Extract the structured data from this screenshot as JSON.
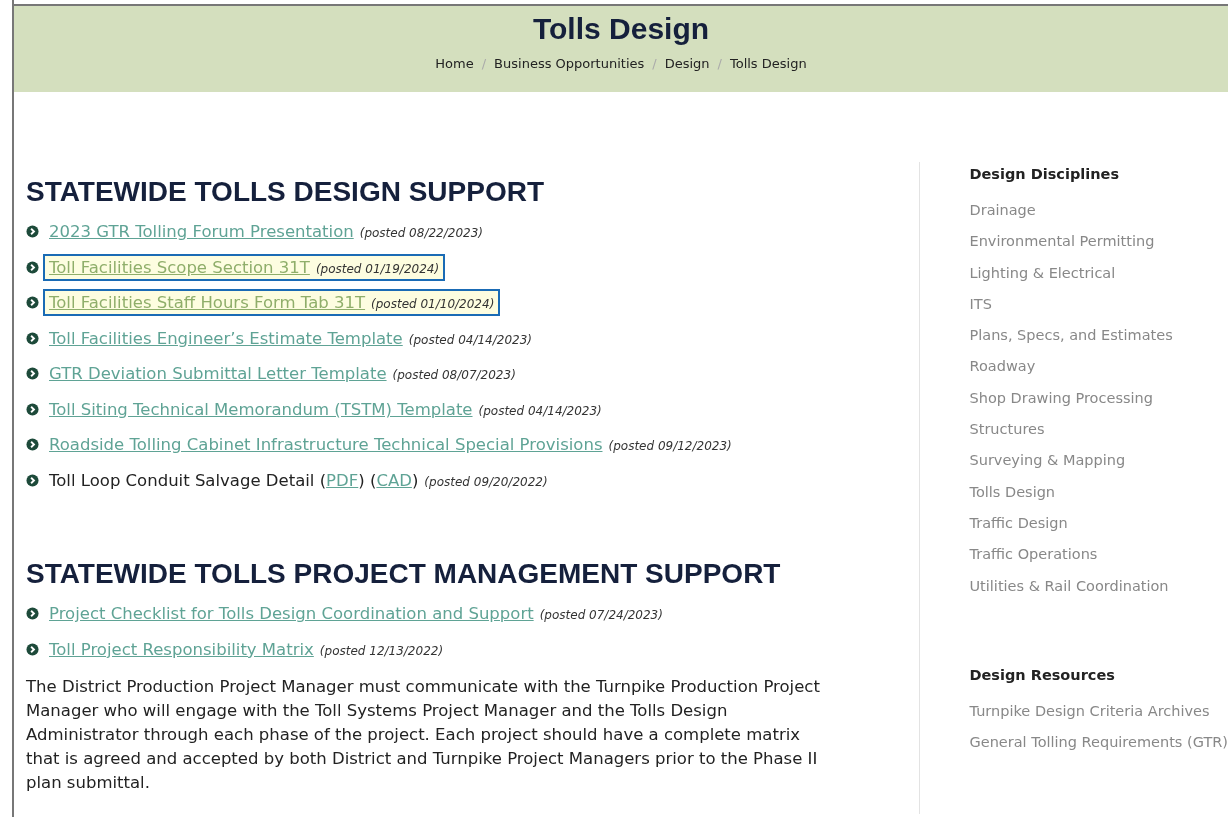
{
  "header": {
    "title": "Tolls Design",
    "breadcrumb": [
      {
        "label": "Home"
      },
      {
        "separator": "/",
        "label": "Business Opportunities"
      },
      {
        "separator": "/",
        "label": "Design"
      },
      {
        "separator": "/",
        "label": "Tolls Design"
      }
    ]
  },
  "sections": [
    {
      "heading": "STATEWIDE TOLLS DESIGN SUPPORT",
      "items": [
        {
          "kind": "link",
          "label": "2023 GTR Tolling Forum Presentation",
          "posted": "(posted 08/22/2023)",
          "highlighted": false
        },
        {
          "kind": "link",
          "label": "Toll Facilities Scope Section 31T",
          "posted": "(posted 01/19/2024)",
          "highlighted": true
        },
        {
          "kind": "link",
          "label": "Toll Facilities Staff Hours Form Tab 31T",
          "posted": "(posted 01/10/2024)",
          "highlighted": true
        },
        {
          "kind": "link",
          "label": "Toll Facilities Engineer’s Estimate Template",
          "posted": "(posted 04/14/2023)",
          "highlighted": false
        },
        {
          "kind": "link",
          "label": "GTR Deviation Submittal Letter Template",
          "posted": "(posted 08/07/2023)",
          "highlighted": false
        },
        {
          "kind": "link",
          "label": "Toll Siting Technical Memorandum (TSTM) Template",
          "posted": "(posted 04/14/2023)",
          "highlighted": false
        },
        {
          "kind": "link",
          "label": "Roadside Tolling Cabinet Infrastructure Technical Special Provisions",
          "posted": "(posted 09/12/2023)",
          "highlighted": false
        },
        {
          "kind": "mixed",
          "parts": [
            {
              "link": false,
              "text": "Toll Loop Conduit Salvage Detail ("
            },
            {
              "link": true,
              "text": "PDF"
            },
            {
              "link": false,
              "text": ") ("
            },
            {
              "link": true,
              "text": "CAD"
            },
            {
              "link": false,
              "text": ")"
            }
          ],
          "posted": "(posted 09/20/2022)",
          "highlighted": false
        }
      ]
    },
    {
      "heading": "STATEWIDE TOLLS PROJECT MANAGEMENT SUPPORT",
      "items": [
        {
          "kind": "link",
          "label": "Project Checklist for Tolls Design Coordination and Support",
          "posted": "(posted 07/24/2023)",
          "highlighted": false
        },
        {
          "kind": "link",
          "label": "Toll Project Responsibility Matrix",
          "posted": "(posted 12/13/2022)",
          "highlighted": false
        }
      ],
      "paragraph": "The District Production Project Manager must communicate with the Turnpike Production Project Manager who will engage with the Toll Systems Project Manager and the Tolls Design Administrator through each phase of the project. Each project should have a complete matrix that is agreed and accepted by both District and Turnpike Project Managers prior to the Phase II plan submittal."
    }
  ],
  "sidebar": [
    {
      "heading": "Design Disciplines",
      "items": [
        "Drainage",
        "Environmental Permitting",
        "Lighting & Electrical",
        "ITS",
        "Plans, Specs, and Estimates",
        "Roadway",
        "Shop Drawing Processing",
        "Structures",
        "Surveying & Mapping",
        "Tolls Design",
        "Traffic Design",
        "Traffic Operations",
        "Utilities & Rail Coordination"
      ]
    },
    {
      "heading": "Design Resources",
      "items": [
        "Turnpike Design Criteria Archives",
        "General Tolling Requirements (GTR)"
      ]
    }
  ]
}
